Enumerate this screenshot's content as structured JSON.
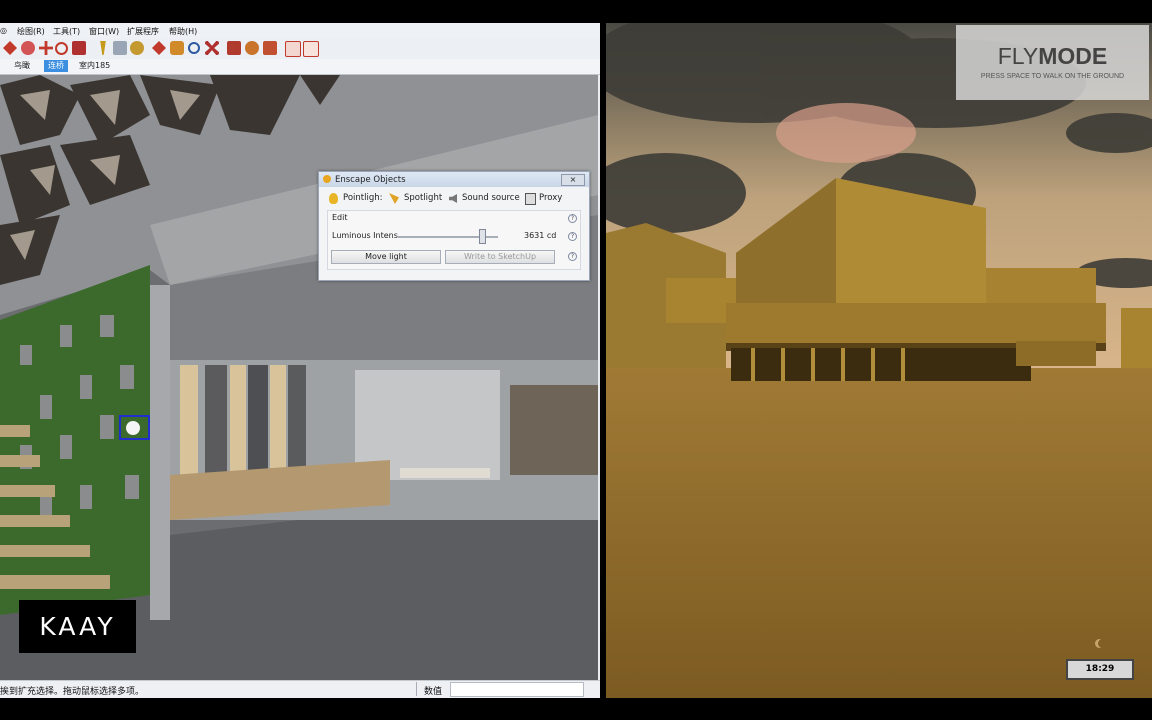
{
  "sketchup": {
    "menu": [
      "绘图(R)",
      "工具(T)",
      "窗口(W)",
      "扩展程序",
      "帮助(H)"
    ],
    "menu_partial_first": "◎",
    "scene_tabs": [
      "鸟瞰",
      "连桥",
      "室内185"
    ],
    "active_tab_index": 1,
    "status_text": "挨到扩充选择。拖动鼠标选择多项。",
    "measure_label": "数值"
  },
  "dialog": {
    "title": "Enscape Objects",
    "close": "×",
    "tabs": [
      "Pointligh:",
      "Spotlight",
      "Sound source",
      "Proxy"
    ],
    "section": "Edit",
    "slider_label": "Luminous Intens",
    "slider_value": "3631 cd",
    "slider_level": 0.84,
    "move_button": "Move light",
    "write_button": "Write to SketchUp",
    "help": "?"
  },
  "enscape": {
    "mode_title_light": "FLY",
    "mode_title_bold": "MODE",
    "mode_subtitle": "PRESS SPACE TO WALK ON THE GROUND",
    "clock": "18:29"
  },
  "logo": "KAAY",
  "colors": {
    "tab_active": "#3c8fe0",
    "enscape_ground": "#8a6a2a",
    "building": "#a88430"
  }
}
